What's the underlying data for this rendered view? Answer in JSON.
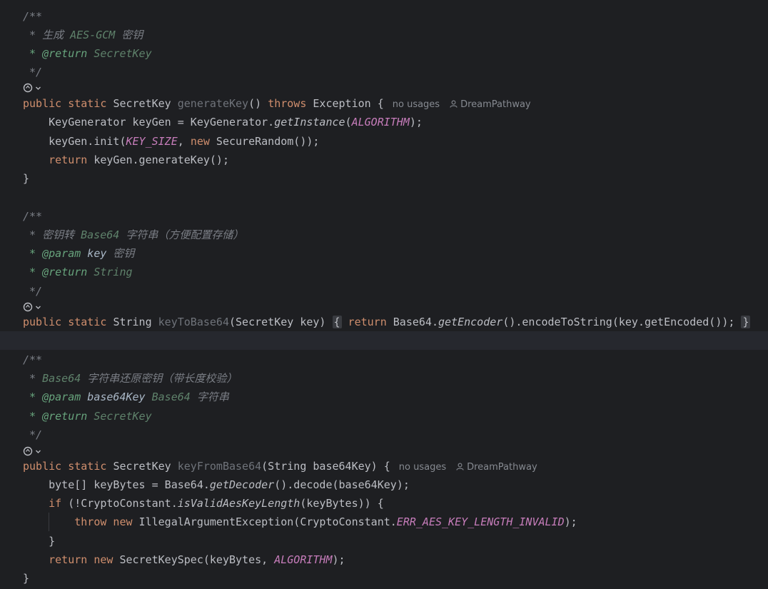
{
  "block1": {
    "doc_open": "/**",
    "doc_summary_prefix": " * 生成 ",
    "doc_summary_code": "AES-GCM",
    "doc_summary_suffix": " 密钥",
    "doc_return_tag": " * @return",
    "doc_return_value": " SecretKey",
    "doc_close": " */",
    "sig_mods": "public static ",
    "sig_type": "SecretKey ",
    "sig_name": "generateKey",
    "sig_params": "() ",
    "sig_throws": "throws",
    "sig_rest": " Exception {",
    "hint_usages": "no usages",
    "hint_author": "DreamPathway",
    "l1_a": "    KeyGenerator keyGen = KeyGenerator.",
    "l1_method": "getInstance",
    "l1_b": "(",
    "l1_const": "ALGORITHM",
    "l1_c": ");",
    "l2_a": "    keyGen.init(",
    "l2_const": "KEY_SIZE",
    "l2_b": ", ",
    "l2_kw": "new",
    "l2_c": " SecureRandom());",
    "l3_kw": "    return",
    "l3_a": " keyGen.generateKey();",
    "close": "}"
  },
  "block2": {
    "doc_open": "/**",
    "doc_summary_prefix": " * 密钥转 ",
    "doc_summary_code": "Base64",
    "doc_summary_suffix": " 字符串（方便配置存储）",
    "doc_param_tag": " * @param",
    "doc_param_name": " key",
    "doc_param_desc": " 密钥",
    "doc_return_tag": " * @return",
    "doc_return_value": " String",
    "doc_close": " */",
    "sig_mods": "public static ",
    "sig_type": "String ",
    "sig_name": "keyToBase64",
    "sig_params": "(SecretKey key) ",
    "fold_open": "{",
    "body_kw": " return",
    "body_a": " Base64.",
    "body_method": "getEncoder",
    "body_b": "().encodeToString(key.getEncoded()); ",
    "fold_close": "}"
  },
  "block3": {
    "doc_open": "/**",
    "doc_summary_prefix": " * ",
    "doc_summary_code": "Base64",
    "doc_summary_suffix": " 字符串还原密钥（带长度校验）",
    "doc_param_tag": " * @param",
    "doc_param_name": " base64Key",
    "doc_param_code": " Base64",
    "doc_param_desc": " 字符串",
    "doc_return_tag": " * @return",
    "doc_return_value": " SecretKey",
    "doc_close": " */",
    "sig_mods": "public static ",
    "sig_type": "SecretKey ",
    "sig_name": "keyFromBase64",
    "sig_params": "(String base64Key) {",
    "hint_usages": "no usages",
    "hint_author": "DreamPathway",
    "l1_a": "    byte[] keyBytes = Base64.",
    "l1_method": "getDecoder",
    "l1_b": "().decode(base64Key);",
    "l2_kw": "    if",
    "l2_a": " (!CryptoConstant.",
    "l2_method": "isValidAesKeyLength",
    "l2_b": "(keyBytes)) {",
    "l3_kw1": "        throw",
    "l3_kw2": " new",
    "l3_a": " IllegalArgumentException(CryptoConstant.",
    "l3_const": "ERR_AES_KEY_LENGTH_INVALID",
    "l3_b": ");",
    "l4": "    }",
    "l5_kw1": "    return",
    "l5_kw2": " new",
    "l5_a": " SecretKeySpec(keyBytes, ",
    "l5_const": "ALGORITHM",
    "l5_b": ");",
    "close": "}"
  },
  "colors": {
    "background": "#1e1f22",
    "current_line": "#26282e",
    "keyword": "#cf8e6d",
    "constant": "#c77dbb",
    "doc_comment": "#5f826b",
    "text": "#bcbec4"
  },
  "icons": [
    "ai-assist-icon",
    "chevron-down-icon",
    "user-icon"
  ]
}
